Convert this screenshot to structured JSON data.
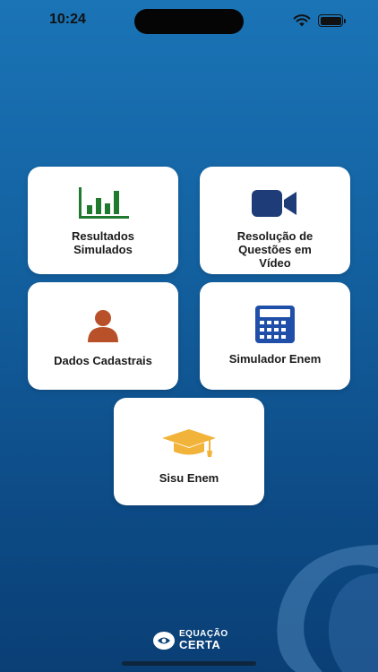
{
  "status_bar": {
    "time": "10:24"
  },
  "tiles": [
    {
      "label": "Resultados\nSimulados",
      "icon": "bar-chart-icon",
      "color": "#1f7a2e"
    },
    {
      "label": "Resolução de\nQuestões em\nVídeo",
      "icon": "video-camera-icon",
      "color": "#1e3d78"
    },
    {
      "label": "Dados Cadastrais",
      "icon": "user-icon",
      "color": "#b8502a"
    },
    {
      "label": "Simulador Enem",
      "icon": "calculator-icon",
      "color": "#1f4fa8"
    },
    {
      "label": "Sisu Enem",
      "icon": "graduation-cap-icon",
      "color": "#f2b33a"
    }
  ],
  "brand": {
    "line1": "EQUAÇÃO",
    "line2": "CERTA"
  },
  "colors": {
    "background_top": "#1a74b6",
    "background_bottom": "#0a3f75",
    "tile_bg": "#ffffff"
  }
}
